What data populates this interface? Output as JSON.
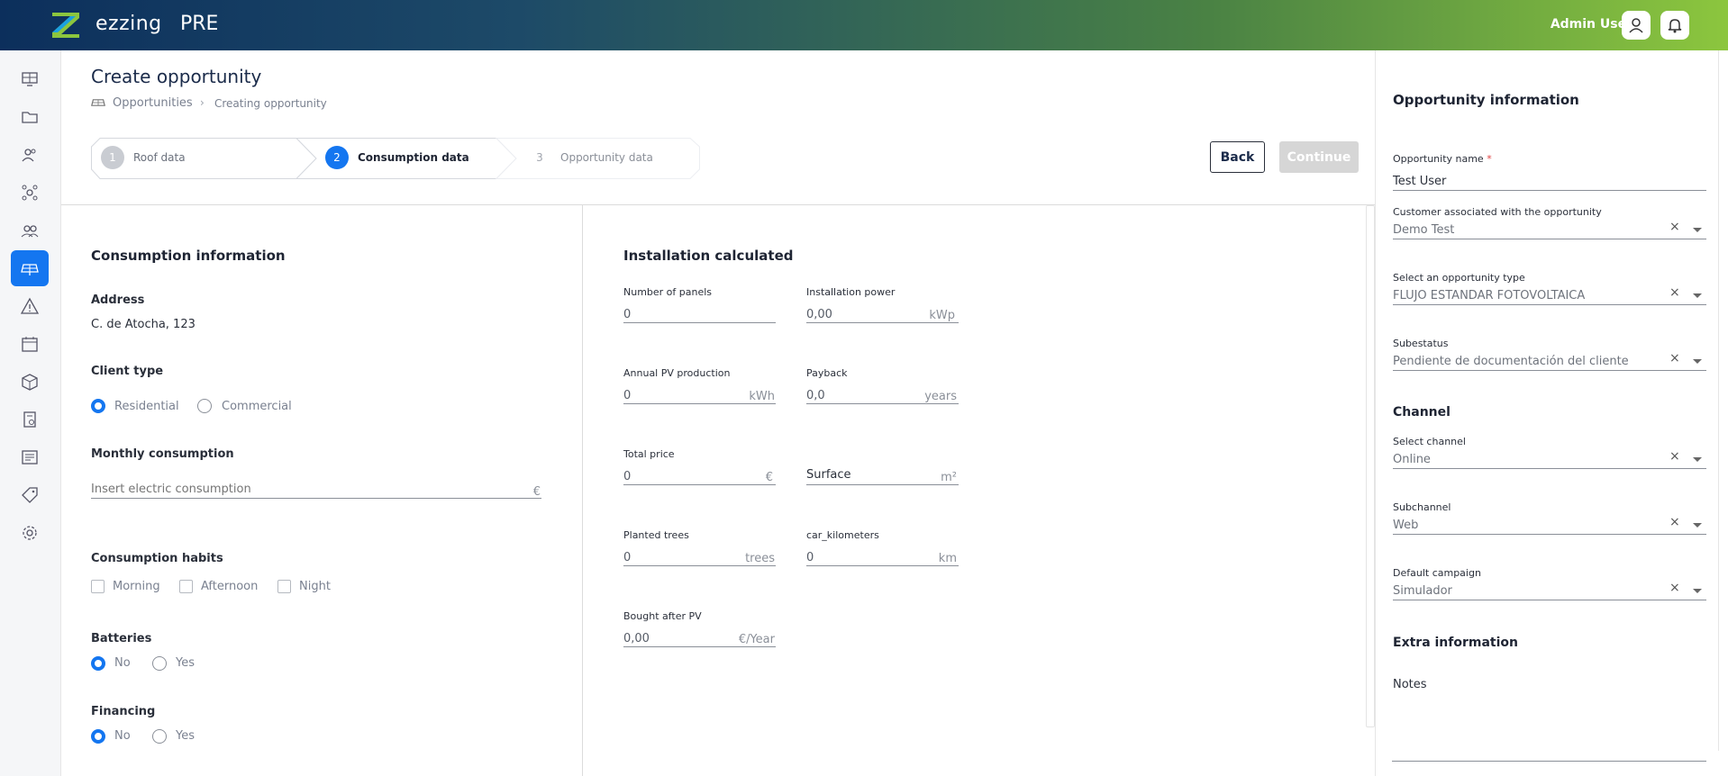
{
  "topbar": {
    "brand": "ezzing",
    "env": "PRE",
    "user_name": "Admin User"
  },
  "sidebar": {
    "items": [
      {
        "icon": "monitor-grid-icon"
      },
      {
        "icon": "folder-icon"
      },
      {
        "icon": "user-group-icon"
      },
      {
        "icon": "network-icon"
      },
      {
        "icon": "team-icon"
      },
      {
        "icon": "solar-panel-icon",
        "active": true
      },
      {
        "icon": "warning-icon"
      },
      {
        "icon": "calendar-icon"
      },
      {
        "icon": "box-icon"
      },
      {
        "icon": "billing-icon"
      },
      {
        "icon": "report-icon"
      },
      {
        "icon": "tag-icon"
      },
      {
        "icon": "settings-icon"
      }
    ]
  },
  "header": {
    "title": "Create opportunity",
    "breadcrumb": [
      "Opportunities",
      "Creating opportunity"
    ],
    "breadcrumb_sep": "›",
    "back_label": "Back",
    "continue_label": "Continue"
  },
  "stepper": {
    "steps": [
      {
        "num": "1",
        "label": "Roof data",
        "state": "done"
      },
      {
        "num": "2",
        "label": "Consumption data",
        "state": "active"
      },
      {
        "num": "3",
        "label": "Opportunity data",
        "state": "pending"
      }
    ]
  },
  "consumption": {
    "title": "Consumption information",
    "address_label": "Address",
    "address_value": "C. de Atocha, 123",
    "client_type_label": "Client type",
    "client_type_options": [
      "Residential",
      "Commercial"
    ],
    "client_type_selected": "Residential",
    "monthly_label": "Monthly consumption",
    "monthly_placeholder": "Insert electric consumption",
    "monthly_unit": "€",
    "habits_label": "Consumption habits",
    "habits_options": [
      "Morning",
      "Afternoon",
      "Night"
    ],
    "batteries_label": "Batteries",
    "batteries_options": [
      "No",
      "Yes"
    ],
    "batteries_selected": "No",
    "financing_label": "Financing",
    "financing_options": [
      "No",
      "Yes"
    ],
    "financing_selected": "No"
  },
  "installation": {
    "title": "Installation calculated",
    "fields": [
      {
        "label": "Number of panels",
        "value": "0",
        "unit": ""
      },
      {
        "label": "Installation power",
        "value": "0,00",
        "unit": "kWp"
      },
      {
        "label": "Annual PV production",
        "value": "0",
        "unit": "kWh"
      },
      {
        "label": "Payback",
        "value": "0,0",
        "unit": "years"
      },
      {
        "label": "Total price",
        "value": "0",
        "unit": "€"
      },
      {
        "label": "",
        "value": "Surface",
        "unit": "m²"
      },
      {
        "label": "Planted trees",
        "value": "0",
        "unit": "trees"
      },
      {
        "label": "car_kilometers",
        "value": "0",
        "unit": "km"
      },
      {
        "label": "Bought after PV",
        "value": "0,00",
        "unit": "€/Year"
      }
    ]
  },
  "opportunity": {
    "title": "Opportunity information",
    "name_label": "Opportunity name",
    "name_required": "*",
    "name_value": "Test User",
    "customer_label": "Customer associated with the opportunity",
    "customer_value": "Demo Test",
    "type_label": "Select an opportunity type",
    "type_value": "FLUJO ESTANDAR FOTOVOLTAICA",
    "substatus_label": "Subestatus",
    "substatus_value": "Pendiente de documentación del cliente",
    "channel_title": "Channel",
    "channel_label": "Select channel",
    "channel_value": "Online",
    "subchannel_label": "Subchannel",
    "subchannel_value": "Web",
    "campaign_label": "Default campaign",
    "campaign_value": "Simulador",
    "extra_title": "Extra information",
    "notes_label": "Notes",
    "clear_symbol": "×"
  }
}
